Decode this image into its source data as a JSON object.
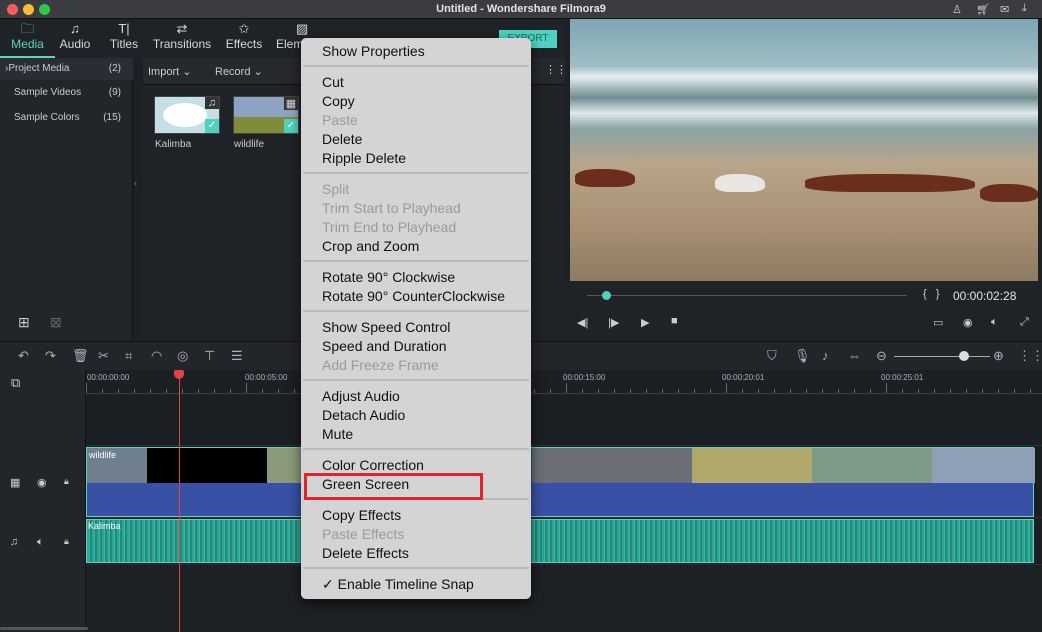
{
  "window": {
    "title": "Untitled - Wondershare Filmora9"
  },
  "tabs": [
    {
      "label": "Media",
      "icon": "folder-icon"
    },
    {
      "label": "Audio",
      "icon": "music-note-icon"
    },
    {
      "label": "Titles",
      "icon": "text-icon"
    },
    {
      "label": "Transitions",
      "icon": "transitions-icon"
    },
    {
      "label": "Effects",
      "icon": "effects-icon"
    },
    {
      "label": "Elem",
      "icon": "image-icon"
    }
  ],
  "export_label": "EXPORT",
  "library": [
    {
      "label": "Project Media",
      "count": "(2)"
    },
    {
      "label": "Sample Videos",
      "count": "(9)"
    },
    {
      "label": "Sample Colors",
      "count": "(15)"
    }
  ],
  "media_toolbar": {
    "import": "Import",
    "record": "Record"
  },
  "media_items": [
    {
      "name": "Kalimba",
      "type": "audio"
    },
    {
      "name": "wildlife",
      "type": "video"
    }
  ],
  "preview": {
    "timecode": "00:00:02:28",
    "progress": 0.06
  },
  "ruler": [
    "00:00:00:00",
    "00:00:05:00",
    "00:00:15:00",
    "00:00:20:01",
    "00:00:25:01"
  ],
  "tracks": {
    "video_clip": "wildlife",
    "audio_clip": "Kalimba"
  },
  "zoom_level": 0.73,
  "colors": {
    "accent": "#4fd1bf",
    "highlight": "#e0242b",
    "playhead": "#e04545"
  },
  "context_menu": [
    [
      {
        "label": "Show Properties",
        "enabled": true
      }
    ],
    [
      {
        "label": "Cut",
        "enabled": true
      },
      {
        "label": "Copy",
        "enabled": true
      },
      {
        "label": "Paste",
        "enabled": false
      },
      {
        "label": "Delete",
        "enabled": true
      },
      {
        "label": "Ripple Delete",
        "enabled": true
      }
    ],
    [
      {
        "label": "Split",
        "enabled": false
      },
      {
        "label": "Trim Start to Playhead",
        "enabled": false
      },
      {
        "label": "Trim End to Playhead",
        "enabled": false
      },
      {
        "label": "Crop and Zoom",
        "enabled": true
      }
    ],
    [
      {
        "label": "Rotate 90° Clockwise",
        "enabled": true
      },
      {
        "label": "Rotate 90° CounterClockwise",
        "enabled": true
      }
    ],
    [
      {
        "label": "Show Speed Control",
        "enabled": true
      },
      {
        "label": "Speed and Duration",
        "enabled": true
      },
      {
        "label": "Add Freeze Frame",
        "enabled": false
      }
    ],
    [
      {
        "label": "Adjust Audio",
        "enabled": true
      },
      {
        "label": "Detach Audio",
        "enabled": true
      },
      {
        "label": "Mute",
        "enabled": true
      }
    ],
    [
      {
        "label": "Color Correction",
        "enabled": true
      },
      {
        "label": "Green Screen",
        "enabled": true,
        "highlighted": true
      }
    ],
    [
      {
        "label": "Copy Effects",
        "enabled": true
      },
      {
        "label": "Paste Effects",
        "enabled": false
      },
      {
        "label": "Delete Effects",
        "enabled": true
      }
    ],
    [
      {
        "label": "✓ Enable Timeline Snap",
        "enabled": true
      }
    ]
  ]
}
